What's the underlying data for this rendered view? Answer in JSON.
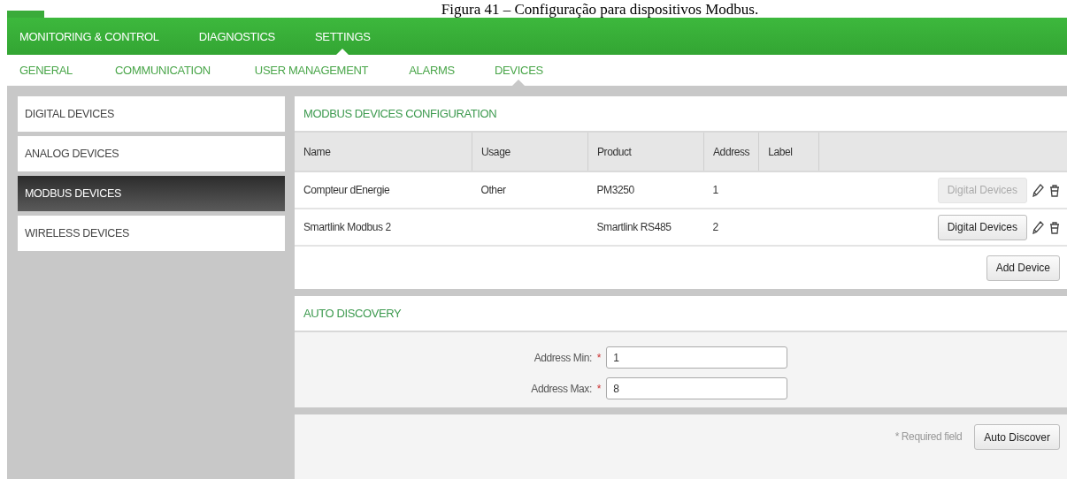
{
  "caption": "Figura 41 – Configuração para dispositivos Modbus.",
  "main_nav": [
    {
      "label": "MONITORING & CONTROL",
      "selected": false
    },
    {
      "label": "DIAGNOSTICS",
      "selected": false
    },
    {
      "label": "SETTINGS",
      "selected": true
    }
  ],
  "sub_nav": [
    {
      "label": "GENERAL",
      "selected": false
    },
    {
      "label": "COMMUNICATION",
      "selected": false
    },
    {
      "label": "USER MANAGEMENT",
      "selected": false
    },
    {
      "label": "ALARMS",
      "selected": false
    },
    {
      "label": "DEVICES",
      "selected": true
    }
  ],
  "sidebar": {
    "items": [
      {
        "label": "DIGITAL DEVICES",
        "selected": false
      },
      {
        "label": "ANALOG DEVICES",
        "selected": false
      },
      {
        "label": "MODBUS DEVICES",
        "selected": true
      },
      {
        "label": "WIRELESS DEVICES",
        "selected": false
      }
    ]
  },
  "devices": {
    "title": "MODBUS DEVICES CONFIGURATION",
    "columns": [
      "Name",
      "Usage",
      "Product",
      "Address",
      "Label"
    ],
    "rows": [
      {
        "cells": [
          "Compteur dEnergie",
          "Other",
          "PM3250",
          "1",
          ""
        ],
        "action": "Digital Devices",
        "disabled": true
      },
      {
        "cells": [
          "Smartlink Modbus 2",
          "",
          "Smartlink RS485",
          "2",
          ""
        ],
        "action": "Digital Devices",
        "disabled": false
      }
    ],
    "add_button": "Add Device"
  },
  "auto_discovery": {
    "title": "AUTO DISCOVERY",
    "fields": [
      {
        "label": "Address Min:",
        "required_mark": "*",
        "value": "1"
      },
      {
        "label": "Address Max:",
        "required_mark": "*",
        "value": "8"
      }
    ],
    "required_note": "* Required field",
    "button": "Auto Discover"
  }
}
